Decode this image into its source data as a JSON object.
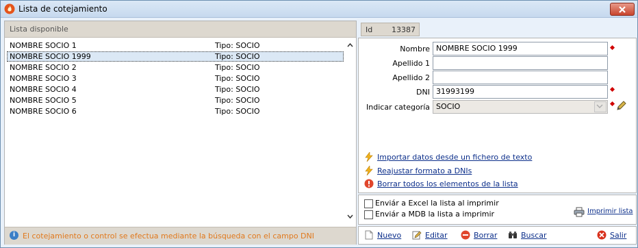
{
  "window": {
    "title": "Lista de cotejamiento"
  },
  "left": {
    "header": "Lista disponible",
    "items": [
      {
        "name": "NOMBRE SOCIO 1",
        "type": "Tipo: SOCIO"
      },
      {
        "name": "NOMBRE SOCIO 1999",
        "type": "Tipo: SOCIO"
      },
      {
        "name": "NOMBRE SOCIO 2",
        "type": "Tipo: SOCIO"
      },
      {
        "name": "NOMBRE SOCIO 3",
        "type": "Tipo: SOCIO"
      },
      {
        "name": "NOMBRE SOCIO 4",
        "type": "Tipo: SOCIO"
      },
      {
        "name": "NOMBRE SOCIO 5",
        "type": "Tipo: SOCIO"
      },
      {
        "name": "NOMBRE SOCIO 6",
        "type": "Tipo: SOCIO"
      }
    ],
    "selected_index": 1,
    "footer": "El cotejamiento o control se efectua mediante la búsqueda con el campo DNI"
  },
  "right": {
    "id": {
      "label": "Id",
      "value": "13387"
    },
    "fields": {
      "nombre": {
        "label": "Nombre",
        "value": "NOMBRE SOCIO 1999"
      },
      "apellido1": {
        "label": "Apellido 1",
        "value": ""
      },
      "apellido2": {
        "label": "Apellido 2",
        "value": ""
      },
      "dni": {
        "label": "DNI",
        "value": "31993199"
      },
      "categoria": {
        "label": "Indicar categoría",
        "value": "SOCIO"
      }
    },
    "actions": {
      "import": "Importar datos desde un fichero de texto",
      "reformat": "Reajustar formato a DNIs",
      "clear": "Borrar todos los elementos de la lista"
    },
    "options": {
      "excel": "Enviár a Excel la lista al imprimir",
      "mdb": "Enviár a MDB la lista a imprimir",
      "print": "Imprimir lista"
    },
    "toolbar": {
      "new": "Nuevo",
      "edit": "Editar",
      "delete": "Borrar",
      "search": "Buscar",
      "exit": "Salir"
    }
  },
  "colors": {
    "required": "#d00000",
    "link": "#0b2e8a",
    "info_text": "#e0781c",
    "panel_header": "#ddd8cf"
  },
  "icons": {
    "app": "app-flame-icon",
    "close": "close-icon",
    "info": "info-icon",
    "lightning": "lightning-icon",
    "warning": "warning-icon",
    "printer": "printer-icon",
    "pencil": "pencil-icon"
  }
}
